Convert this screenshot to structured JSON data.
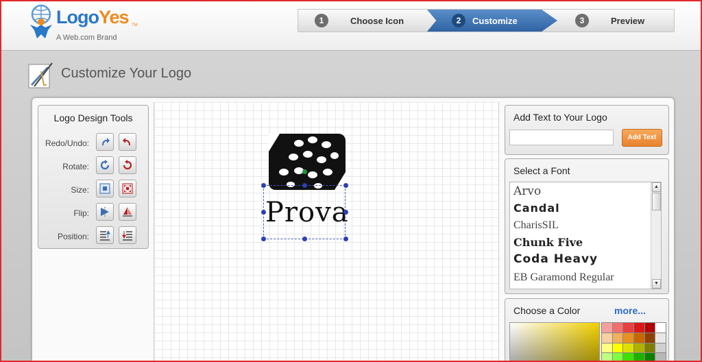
{
  "brand": {
    "name_part1": "Logo",
    "name_part2": "Yes",
    "tm": "TM",
    "tagline": "A Web.com Brand"
  },
  "steps": [
    {
      "num": "1",
      "label": "Choose Icon"
    },
    {
      "num": "2",
      "label": "Customize"
    },
    {
      "num": "3",
      "label": "Preview"
    }
  ],
  "page_title": "Customize Your Logo",
  "tools": {
    "title": "Logo Design Tools",
    "rows": [
      {
        "label": "Redo/Undo:",
        "icons": [
          "redo-icon",
          "undo-icon"
        ]
      },
      {
        "label": "Rotate:",
        "icons": [
          "rotate-right-icon",
          "rotate-left-icon"
        ]
      },
      {
        "label": "Size:",
        "icons": [
          "shrink-icon",
          "enlarge-icon"
        ]
      },
      {
        "label": "Flip:",
        "icons": [
          "flip-horizontal-icon",
          "flip-vertical-icon"
        ]
      },
      {
        "label": "Position:",
        "icons": [
          "bring-forward-icon",
          "send-backward-icon"
        ]
      }
    ]
  },
  "canvas": {
    "logo_text": "Prova"
  },
  "add_text": {
    "title": "Add Text to Your Logo",
    "input_value": "",
    "button_label": "Add Text"
  },
  "font": {
    "title": "Select a Font",
    "items": [
      "Arvo",
      "Candal",
      "CharisSIL",
      "Chunk Five",
      "Coda Heavy",
      "EB Garamond Regular"
    ]
  },
  "color": {
    "title": "Choose a Color",
    "more_label": "more...",
    "swatches": [
      "#f4a0a0",
      "#f07070",
      "#e84040",
      "#d81818",
      "#b00000",
      "#ffffff",
      "#f8d0a0",
      "#f0b060",
      "#e89020",
      "#c86800",
      "#904000",
      "#e8e8e8",
      "#ffff80",
      "#ffff00",
      "#e0e000",
      "#b0b000",
      "#808000",
      "#d0d0d0",
      "#c0ff80",
      "#80ff40",
      "#40e000",
      "#20b000",
      "#108000",
      "#b8b8b8"
    ]
  }
}
